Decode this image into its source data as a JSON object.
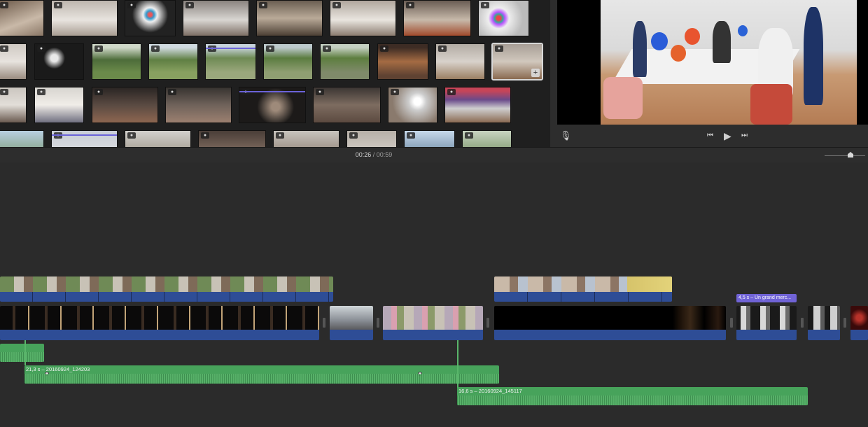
{
  "timecode": {
    "current": "00:26",
    "separator": "/",
    "total": "00:59"
  },
  "audio_clips": [
    {
      "label": "21,3 s – 20160924_124203"
    },
    {
      "label": "16,6 s – 20160924_145117"
    }
  ],
  "title_clip": {
    "label": "4,5 s – Un grand merc..."
  },
  "icons": {
    "camera": "camera-icon",
    "add": "add-icon",
    "microphone": "microphone-icon",
    "skip_back": "skip-back-icon",
    "play": "play-icon",
    "skip_forward": "skip-forward-icon"
  },
  "colors": {
    "video_bar": "#2e4d96",
    "audio": "#47a35b",
    "title": "#7063d6",
    "selection": "#d8d8d8"
  }
}
